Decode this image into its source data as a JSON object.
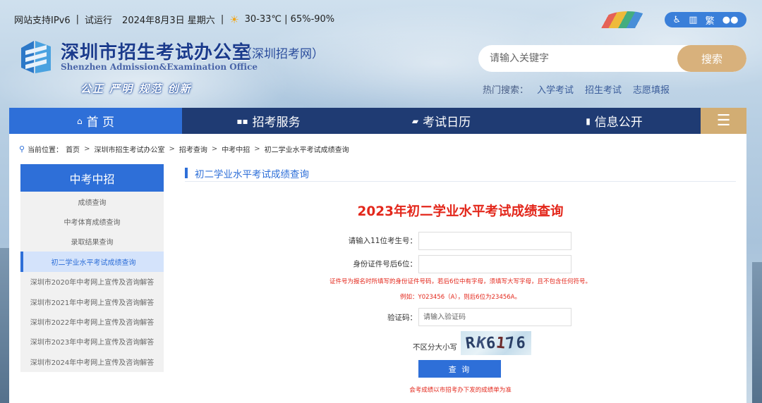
{
  "topbar": {
    "ipv6": "网站支持IPv6",
    "trial": "试运行",
    "date": "2024年8月3日 星期六",
    "weather": "30-33℃ | 65%-90%",
    "tools": {
      "traditional": "繁"
    }
  },
  "logo": {
    "title": "深圳市招生考试办公室",
    "subtitle": "（深圳招考网）",
    "english": "Shenzhen Admission&Examination Office",
    "motto": "公正 严明 规范 创新"
  },
  "search": {
    "placeholder": "请输入关键字",
    "button": "搜索"
  },
  "hot": {
    "label": "热门搜索：",
    "links": [
      "入学考试",
      "招生考试",
      "志愿填报"
    ]
  },
  "nav": {
    "home": "首 页",
    "service": "招考服务",
    "calendar": "考试日历",
    "info": "信息公开",
    "menu": "☰"
  },
  "breadcrumb": {
    "label": "当前位置：",
    "items": [
      "首页",
      "深圳市招生考试办公室",
      "招考查询",
      "中考中招",
      "初二学业水平考试成绩查询"
    ]
  },
  "sidebar": {
    "title": "中考中招",
    "items": [
      "成绩查询",
      "中考体育成绩查询",
      "录取结果查询",
      "初二学业水平考试成绩查询",
      "深圳市2020年中考网上宣传及咨询解答",
      "深圳市2021年中考网上宣传及咨询解答",
      "深圳市2022年中考网上宣传及咨询解答",
      "深圳市2023年中考网上宣传及咨询解答",
      "深圳市2024年中考网上宣传及咨询解答"
    ]
  },
  "panel": {
    "title": "初二学业水平考试成绩查询"
  },
  "form": {
    "title": "2023年初二学业水平考试成绩查询",
    "exam_no_label": "请输入11位考生号：",
    "id_label": "身份证件号后6位：",
    "note1": "证件号为报名时所填写的身份证件号码，若后6位中有字母，须填写大写字母，且不包含任何符号。",
    "note2": "例如：Y023456（A），则后6位为23456A。",
    "captcha_label": "验证码：",
    "captcha_placeholder": "请输入验证码",
    "case_hint": "不区分大小写",
    "captcha_chars": [
      "R",
      "K",
      "6",
      "1",
      "7",
      "6"
    ],
    "submit": "查 询",
    "footer": "会考成绩以市招考办下发的成绩单为准"
  },
  "colors": {
    "primary": "#2e6fd8",
    "navy": "#1f3b73",
    "gold": "#d2ad73",
    "alert": "#e3271b"
  }
}
